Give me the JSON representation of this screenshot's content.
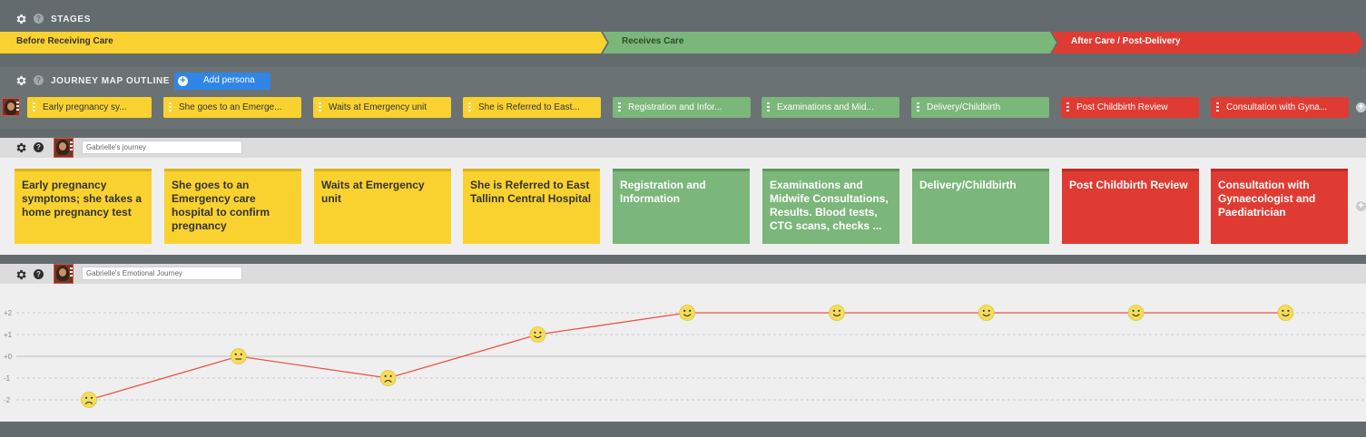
{
  "sections": {
    "stages_title": "STAGES",
    "outline_title": "JOURNEY MAP OUTLINE",
    "add_persona": "Add persona"
  },
  "stages": [
    {
      "label": "Before Receiving Care",
      "color": "#fad22f"
    },
    {
      "label": "Receives Care",
      "color": "#7bb67a"
    },
    {
      "label": "After Care / Post-Delivery",
      "color": "#e03b33"
    }
  ],
  "outline_steps": [
    "Early pregnancy sy...",
    "She goes to an Emerge...",
    "Waits at Emergency unit",
    "She is Referred to East...",
    "Registration and Infor...",
    "Examinations and Mid...",
    "Delivery/Childbirth",
    "Post Childbirth Review",
    "Consultation with Gyna..."
  ],
  "journey": {
    "name": "Gabrielle's journey",
    "cards": [
      "Early pregnancy symptoms; she takes a home pregnancy test",
      "She goes to an Emergency care hospital to confirm pregnancy",
      "Waits at Emergency unit",
      "She is Referred to East Tallinn Central Hospital",
      "Registration and Information",
      "Examinations and Midwife Consultations, Results. Blood tests, CTG scans, checks ...",
      "Delivery/Childbirth",
      "Post Childbirth Review",
      "Consultation with Gynaecologist and Paediatrician"
    ]
  },
  "emotional": {
    "name": "Gabrielle's Emotional Journey",
    "y_ticks": [
      "+2",
      "+1",
      "+0",
      "-1",
      "-2"
    ]
  },
  "chart_data": {
    "type": "line",
    "x": [
      1,
      2,
      3,
      4,
      5,
      6,
      7,
      8,
      9
    ],
    "values": [
      -2,
      0,
      -1,
      1,
      2,
      2,
      2,
      2,
      2
    ],
    "faces": [
      "sad",
      "neutral",
      "sad",
      "happy",
      "happy",
      "happy",
      "happy",
      "happy",
      "happy"
    ],
    "ylim": [
      -3,
      3
    ],
    "line_color": "#ee5248",
    "face_color": "#f5dd5b",
    "grid": true
  }
}
